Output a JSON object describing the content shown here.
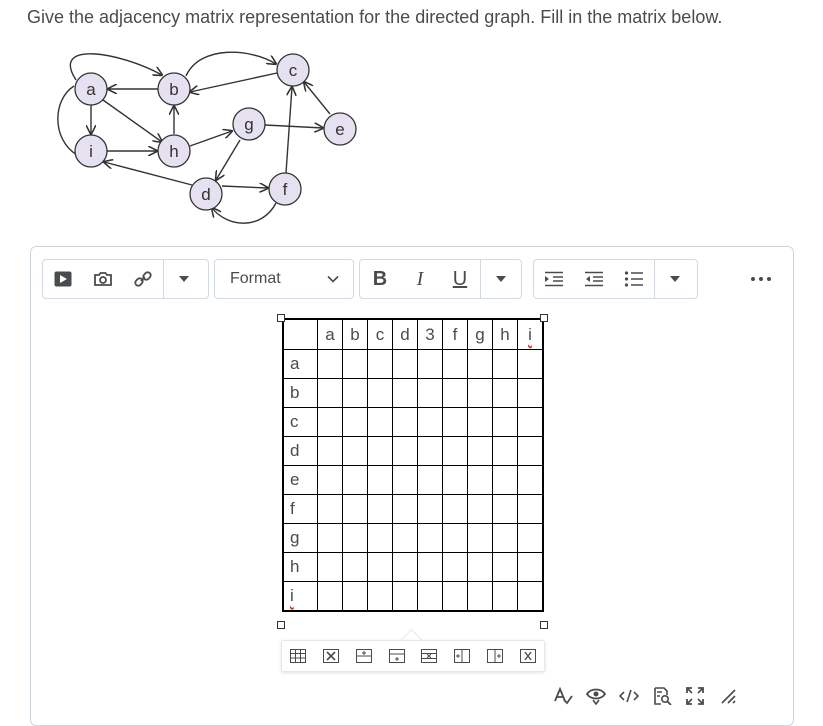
{
  "question": {
    "text": "Give the adjacency matrix representation for the directed graph. Fill in the matrix below."
  },
  "graph": {
    "nodes": [
      "a",
      "b",
      "c",
      "e",
      "g",
      "i",
      "h",
      "d",
      "f"
    ]
  },
  "toolbar": {
    "insert_group": [
      "video-icon",
      "camera-icon",
      "link-icon",
      "chevron-down-icon"
    ],
    "format_label": "Format",
    "text_group": {
      "bold": "B",
      "italic": "I",
      "underline": "U"
    },
    "list_group": [
      "indent-icon",
      "outdent-icon",
      "bulleted-list-icon",
      "chevron-down-icon"
    ],
    "more": "more-options-icon"
  },
  "matrix": {
    "col_headers": [
      "",
      "a",
      "b",
      "c",
      "d",
      "3",
      "f",
      "g",
      "h",
      "i"
    ],
    "row_headers": [
      "a",
      "b",
      "c",
      "d",
      "e",
      "f",
      "g",
      "h",
      "i"
    ]
  },
  "table_toolbar": [
    "table-properties-icon",
    "delete-table-icon",
    "insert-row-before-icon",
    "insert-row-after-icon",
    "delete-row-icon",
    "insert-column-before-icon",
    "insert-column-after-icon",
    "delete-column-icon"
  ],
  "bottom_toolbar": [
    "spellcheck-icon",
    "preview-icon",
    "source-code-icon",
    "find-replace-icon",
    "fullscreen-icon",
    "resize-handle-icon"
  ],
  "colors": {
    "node_fill": "#e6e1f0",
    "text": "#494c4e",
    "editor_border": "#cdd5dc",
    "spell_error": "#c23b22"
  }
}
